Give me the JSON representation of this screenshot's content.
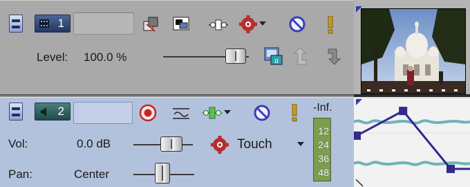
{
  "video_track": {
    "number": "1",
    "level_label": "Level:",
    "level_value": "100.0 %",
    "level_fraction": 1.0
  },
  "audio_track": {
    "number": "2",
    "vol_label": "Vol:",
    "vol_value": "0.0 dB",
    "pan_label": "Pan:",
    "pan_value": "Center",
    "automation_mode": "Touch",
    "meter_peak": "-Inf.",
    "meter_ticks": [
      "12",
      "24",
      "36",
      "48"
    ]
  },
  "icons": {
    "composite_mode": "composite-mode-icon",
    "track_fx": "track-fx-icon",
    "motion": "track-motion-icon",
    "gear": "gear-icon",
    "mute": "mute-icon",
    "solo": "solo-icon",
    "arm_record": "record-arm-icon",
    "invert_phase": "invert-phase-icon",
    "compositing_parent": "make-compositing-parent-icon",
    "compositing_child": "make-compositing-child-icon",
    "generated_media": "generated-media-icon"
  },
  "colors": {
    "video_header_bg": "#a9a9a9",
    "audio_header_bg": "#b3c2dc",
    "envelope_color": "#2f2a8c",
    "meter_bg": "#7b9d4f"
  },
  "timeline": {
    "envelope_points": [
      {
        "t": 0.0,
        "v": 0.55
      },
      {
        "t": 0.42,
        "v": 0.9
      },
      {
        "t": 0.85,
        "v": 0.08
      }
    ]
  }
}
